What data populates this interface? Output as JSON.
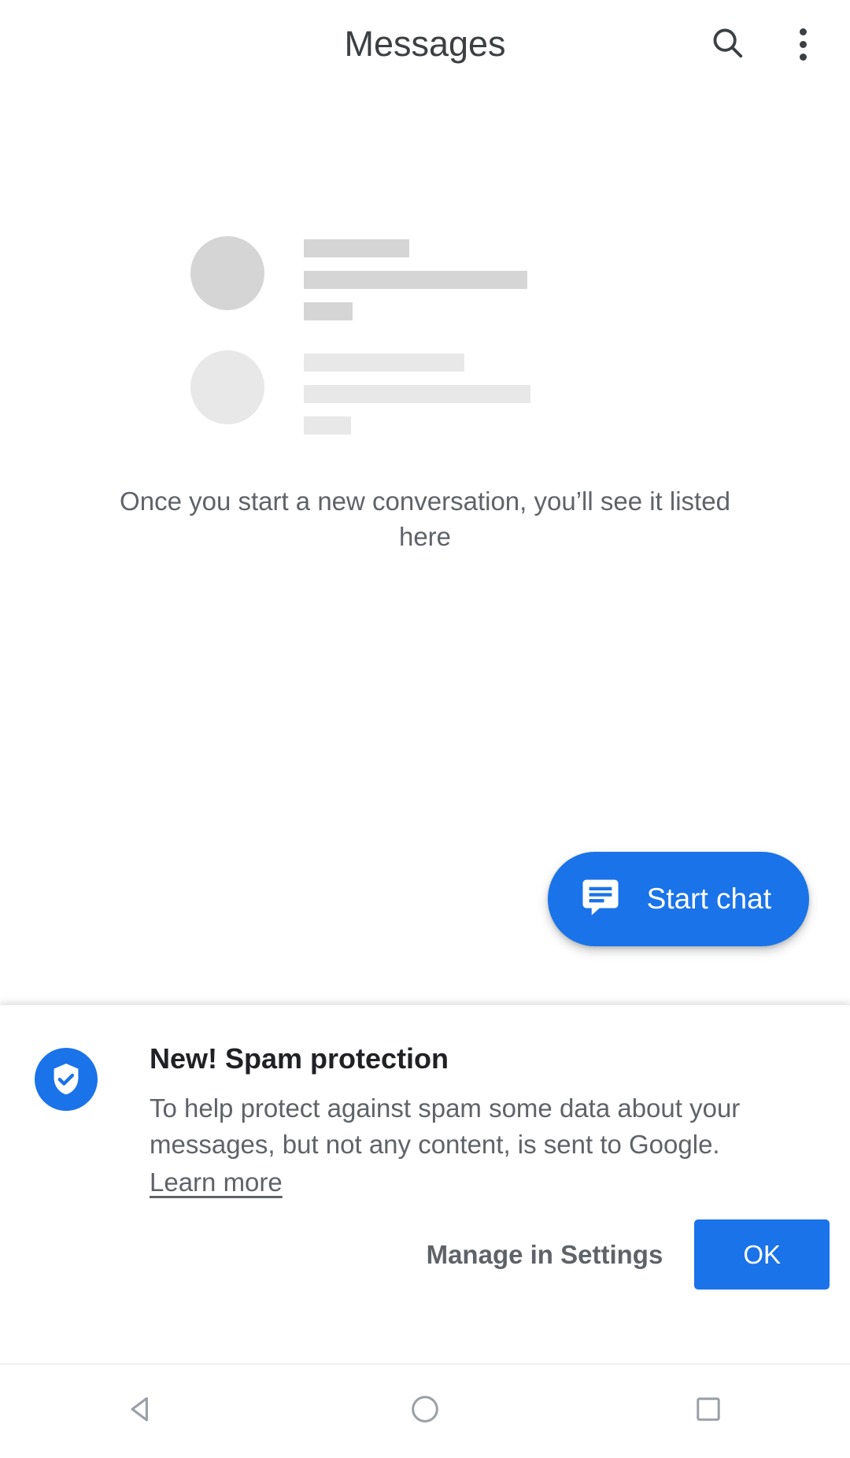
{
  "appbar": {
    "title": "Messages",
    "search_icon": "search-icon",
    "overflow_icon": "more-vert-icon"
  },
  "empty_state": {
    "message": "Once you start a new conversation, you’ll see it listed here",
    "skeleton": {
      "row1_color": "#d5d5d5",
      "row2_color": "#e8e8e8"
    }
  },
  "fab": {
    "label": "Start chat",
    "icon": "chat-bubble-icon",
    "color": "#1a73e8"
  },
  "spam_card": {
    "icon": "shield-check-icon",
    "icon_bg": "#1a73e8",
    "title": "New! Spam protection",
    "body": "To help protect against spam some data about your messages, but not any content, is sent to Google.",
    "link_label": "Learn more",
    "secondary_button": "Manage in Settings",
    "primary_button": "OK",
    "primary_button_color": "#1a73e8"
  },
  "navbar": {
    "back": "back-triangle-icon",
    "home": "home-circle-icon",
    "recents": "recents-square-icon"
  }
}
